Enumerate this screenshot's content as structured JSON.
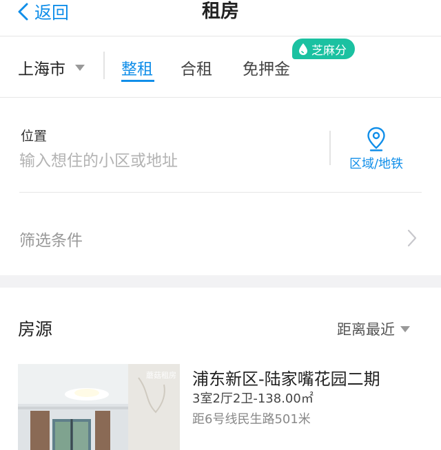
{
  "nav": {
    "back_label": "返回",
    "title": "租房"
  },
  "tabs_bar": {
    "city": "上海市",
    "tabs": [
      {
        "label": "整租",
        "active": true
      },
      {
        "label": "合租",
        "active": false
      },
      {
        "label": "免押金",
        "active": false
      }
    ],
    "badge": "芝麻分"
  },
  "location": {
    "label": "位置",
    "placeholder": "输入想住的小区或地址",
    "area_button": "区域/地铁"
  },
  "filter": {
    "label": "筛选条件"
  },
  "listings_section": {
    "title": "房源",
    "sort": "距离最近"
  },
  "listings": [
    {
      "title": "浦东新区-陆家嘴花园二期",
      "spec": "3室2厅2卫-138.00㎡",
      "distance": "距6号线民生路501米",
      "watermark": "蘑菇租房"
    }
  ],
  "colors": {
    "accent": "#108ee9",
    "badge": "#1bc1a1",
    "divider": "#e6e6e6",
    "section_gap": "#f2f2f4"
  }
}
